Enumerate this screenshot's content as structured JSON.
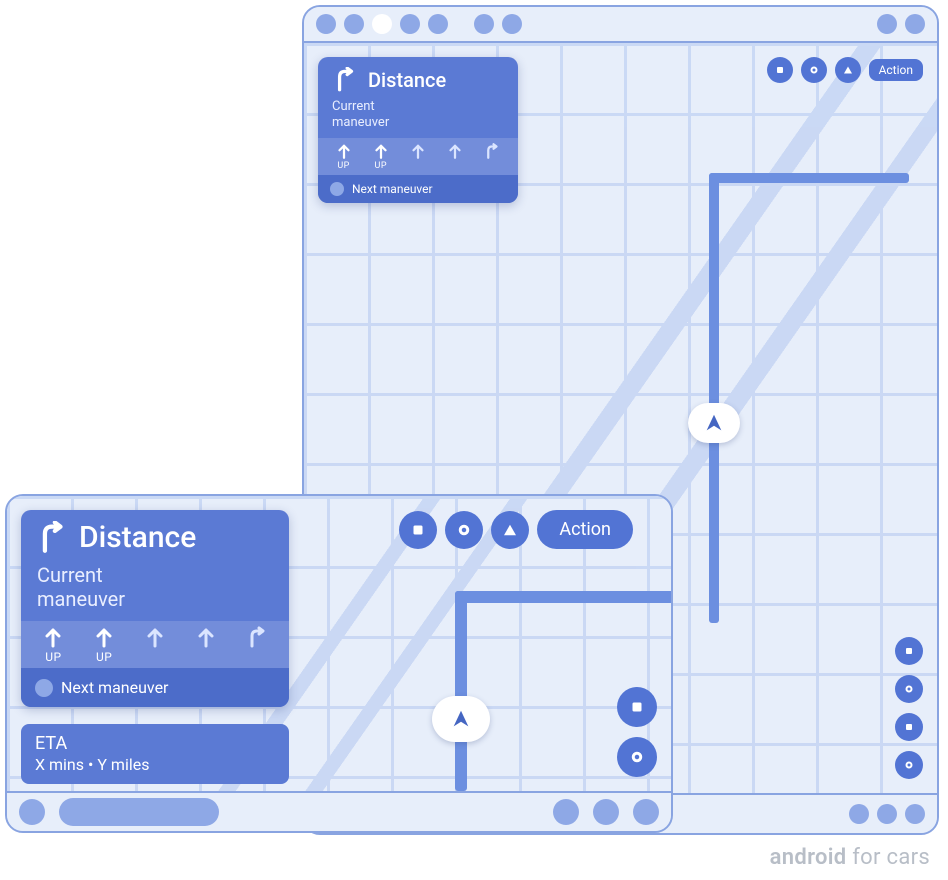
{
  "watermark": {
    "brand_bold": "android",
    "brand_rest": " for cars"
  },
  "portrait": {
    "nav_card": {
      "distance": "Distance",
      "current_maneuver": "Current\nmaneuver",
      "lanes": [
        {
          "shape": "up",
          "label": "UP"
        },
        {
          "shape": "up",
          "label": "UP"
        },
        {
          "shape": "up",
          "label": ""
        },
        {
          "shape": "up",
          "label": ""
        },
        {
          "shape": "right",
          "label": ""
        }
      ],
      "next_maneuver": "Next maneuver"
    },
    "actions": {
      "buttons": [
        "square",
        "circle",
        "triangle"
      ],
      "chip_label": "Action"
    },
    "side_buttons": [
      "square",
      "circle",
      "square",
      "circle"
    ]
  },
  "landscape": {
    "nav_card": {
      "distance": "Distance",
      "current_maneuver": "Current\nmaneuver",
      "lanes": [
        {
          "shape": "up",
          "label": "UP"
        },
        {
          "shape": "up",
          "label": "UP"
        },
        {
          "shape": "up",
          "label": ""
        },
        {
          "shape": "up",
          "label": ""
        },
        {
          "shape": "right",
          "label": ""
        }
      ],
      "next_maneuver": "Next maneuver"
    },
    "eta": {
      "title": "ETA",
      "detail": "X mins • Y miles"
    },
    "actions": {
      "buttons": [
        "square",
        "circle",
        "triangle"
      ],
      "chip_label": "Action"
    },
    "side_buttons": [
      "square",
      "circle"
    ]
  }
}
